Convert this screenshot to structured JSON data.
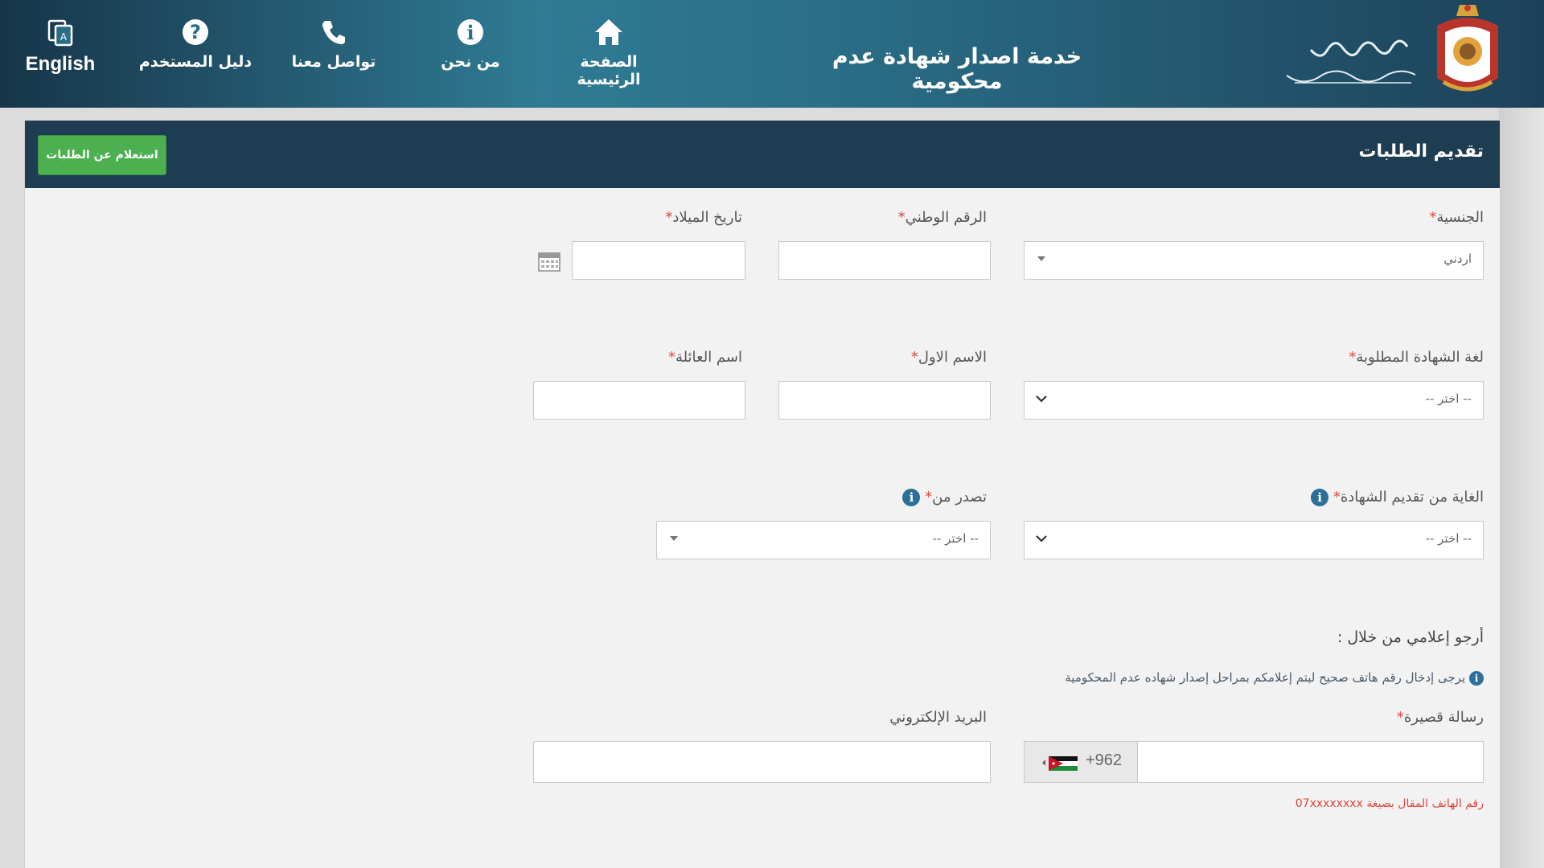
{
  "header": {
    "title": "خدمة اصدار شهادة عدم محكومية",
    "nav": {
      "english": "English",
      "guide": "دليل المستخدم",
      "contact": "تواصل معنا",
      "about": "من نحن",
      "home": "الصفحة الرئيسية"
    }
  },
  "panel": {
    "title": "تقديم الطلبات",
    "inquiry_button": "استعلام عن الطلبات"
  },
  "form": {
    "nationality": {
      "label": "الجنسية",
      "required": "*",
      "value": "اردني"
    },
    "national_id": {
      "label": "الرقم الوطني",
      "required": "*",
      "value": ""
    },
    "birth_date": {
      "label": "تاريخ الميلاد",
      "required": "*",
      "value": ""
    },
    "cert_language": {
      "label": "لغة الشهادة المطلوبة",
      "required": "*",
      "value": "-- اختر --"
    },
    "first_name": {
      "label": "الاسم الاول",
      "required": "*",
      "value": ""
    },
    "family_name": {
      "label": "اسم العائلة",
      "required": "*",
      "value": ""
    },
    "purpose": {
      "label": "الغاية من تقديم الشهادة",
      "required": "*",
      "value": "-- اختر --"
    },
    "issued_from": {
      "label": "تصدر من",
      "required": "*",
      "value": "-- اختر --"
    },
    "notify_heading": "أرجو إعلامي من خلال :",
    "notify_notice": "يرجى إدخال رقم هاتف صحيح ليتم إعلامكم بمراحل إصدار شهاده عدم المحكومية",
    "sms": {
      "label": "رسالة قصيرة",
      "required": "*",
      "country_code": "+962",
      "value": ""
    },
    "email": {
      "label": "البريد الإلكتروني",
      "value": ""
    },
    "phone_hint": "رقم الهاتف المقال بصيغة 07xxxxxxxx"
  },
  "colors": {
    "header_dark": "#173549",
    "header_mid": "#2f7b94",
    "panel_head": "#1f3d52",
    "button_green": "#4caf50",
    "required_red": "#e0453b",
    "info_blue": "#2b6f9a"
  }
}
